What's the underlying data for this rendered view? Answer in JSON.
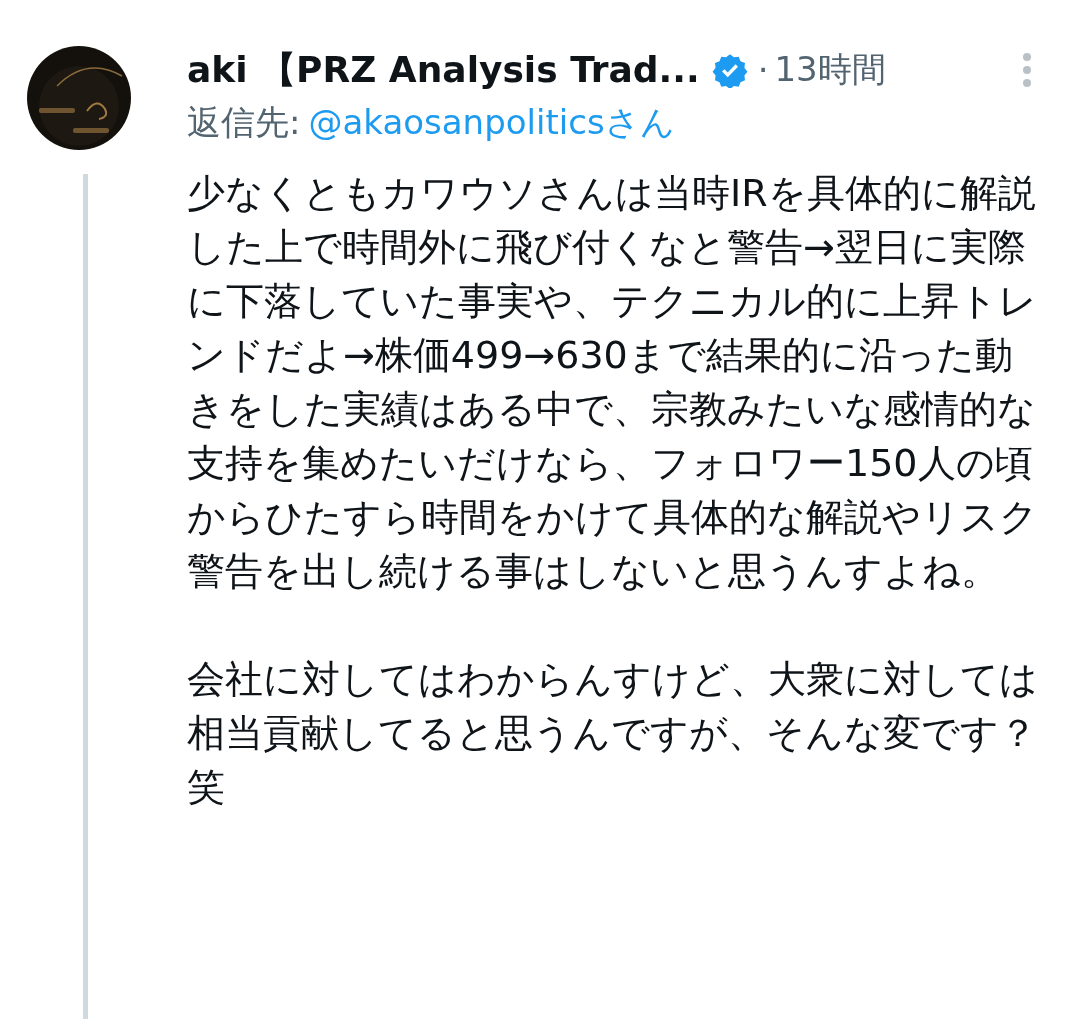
{
  "tweet": {
    "author_name": "aki 【PRZ Analysis Trad...",
    "verified": true,
    "separator": "·",
    "time": "13時間",
    "reply_label": "返信先:",
    "reply_to": "@akaosanpoliticsさん",
    "paragraphs": [
      "少なくともカワウソさんは当時IRを具体的に解説した上で時間外に飛び付くなと警告→翌日に実際に下落していた事実や、テクニカル的に上昇トレンドだよ→株価499→630まで結果的に沿った動きをした実績はある中で、宗教みたいな感情的な支持を集めたいだけなら、フォロワー150人の頃からひたすら時間をかけて具体的な解説やリスク警告を出し続ける事はしないと思うんすよね。",
      "会社に対してはわからんすけど、大衆に対しては相当貢献してると思うんですが、そんな変です？笑"
    ]
  }
}
